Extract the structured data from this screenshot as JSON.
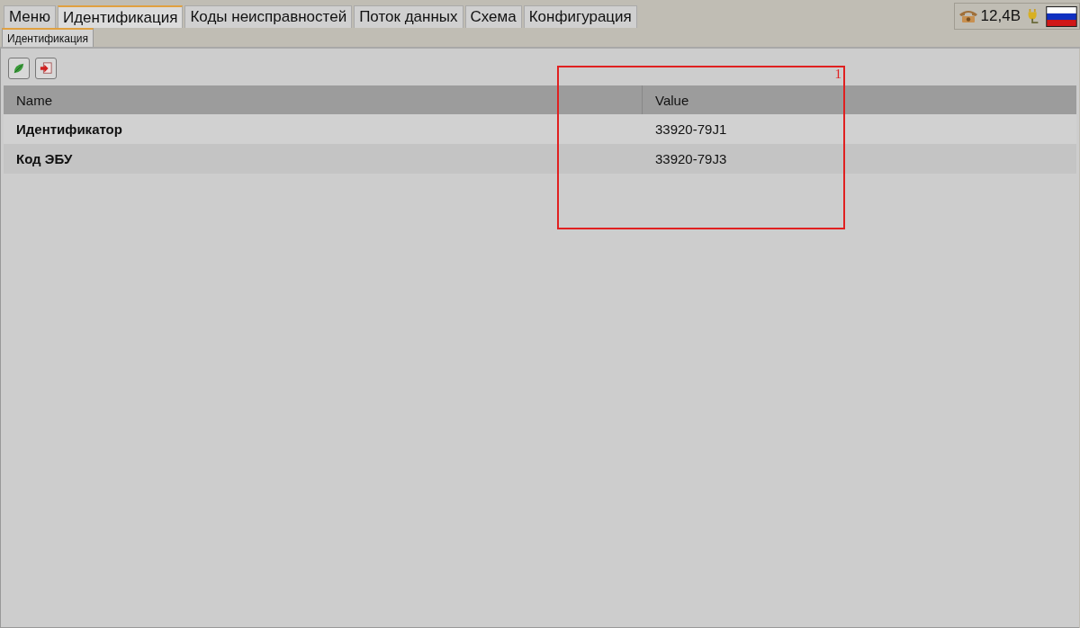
{
  "tabs": [
    {
      "label": "Меню",
      "selected": false
    },
    {
      "label": "Идентификация",
      "selected": true
    },
    {
      "label": "Коды неисправностей",
      "selected": false
    },
    {
      "label": "Поток данных",
      "selected": false
    },
    {
      "label": "Схема",
      "selected": false
    },
    {
      "label": "Конфигурация",
      "selected": false
    }
  ],
  "status": {
    "voltage": "12,4В"
  },
  "subtabs": [
    {
      "label": "Идентификация",
      "selected": true
    }
  ],
  "table": {
    "columns": [
      "Name",
      "Value"
    ],
    "rows": [
      {
        "name": "Идентификатор",
        "value": "33920-79J1"
      },
      {
        "name": "Код ЭБУ",
        "value": "33920-79J3"
      }
    ]
  },
  "annotations": [
    {
      "label": "1"
    }
  ]
}
